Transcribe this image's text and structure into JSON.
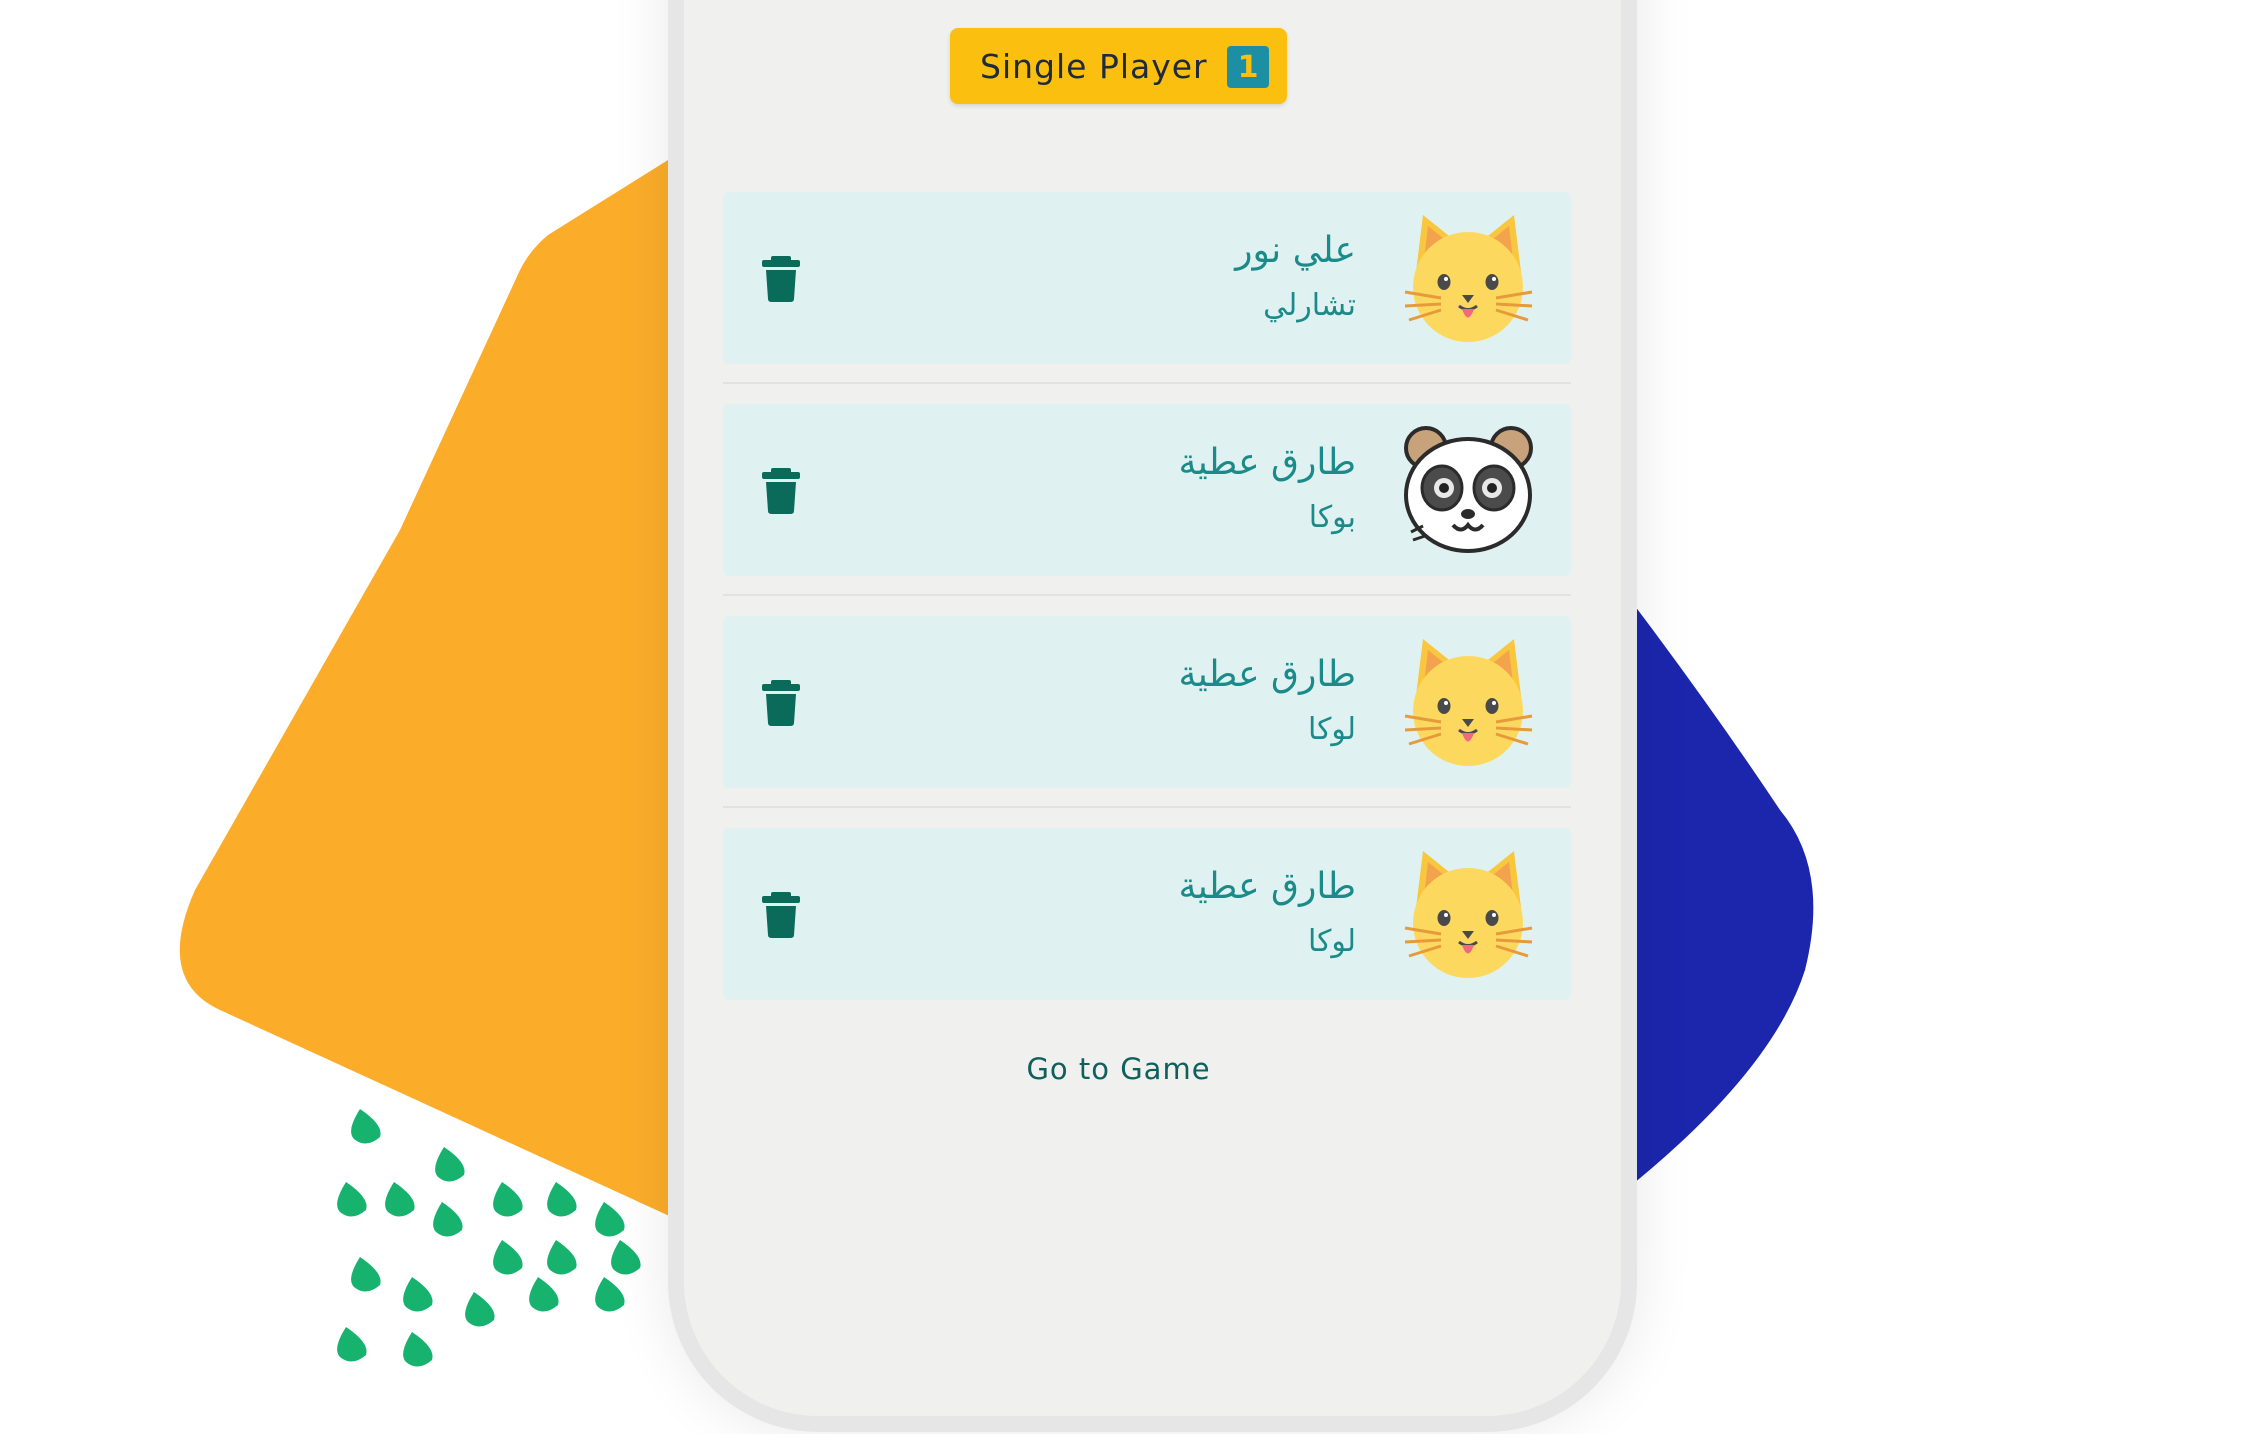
{
  "header": {
    "mode_label": "Single Player",
    "player_count": "1"
  },
  "players": [
    {
      "name": "علي نور",
      "pet": "تشارلي",
      "avatar": "cat-icon"
    },
    {
      "name": "طارق عطية",
      "pet": "بوكا",
      "avatar": "panda-icon"
    },
    {
      "name": "طارق عطية",
      "pet": "لوكا",
      "avatar": "cat-icon"
    },
    {
      "name": "طارق عطية",
      "pet": "لوكا",
      "avatar": "cat-icon"
    }
  ],
  "footer": {
    "go_label": "Go to Game"
  },
  "colors": {
    "badge": "#fbbf0f",
    "badge_count": "#1d8fa5",
    "card": "#e0f1f1",
    "text_teal": "#1b8b8a",
    "trash": "#0b6b5a",
    "shape_orange": "#fbad2a",
    "shape_blue": "#1b26ad",
    "dots_green": "#17b36e"
  }
}
